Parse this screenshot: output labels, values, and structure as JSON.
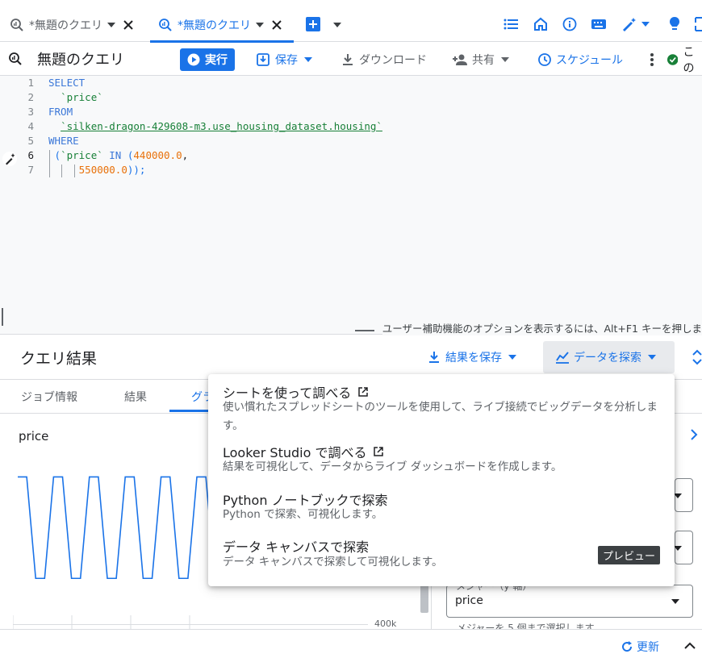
{
  "tabs": [
    {
      "label": "*無題のクエリ",
      "active": false
    },
    {
      "label": "*無題のクエリ",
      "active": true
    }
  ],
  "query": {
    "title": "無題のクエリ",
    "run_label": "実行",
    "save_label": "保存",
    "download_label": "ダウンロード",
    "share_label": "共有",
    "schedule_label": "スケジュール",
    "status_label": "この"
  },
  "editor": {
    "line_numbers": [
      "1",
      "2",
      "3",
      "4",
      "5",
      "6",
      "7"
    ],
    "kw_select": "SELECT",
    "col_price": "`price`",
    "kw_from": "FROM",
    "table_ref": "`silken-dragon-429608-m3.use_housing_dataset.housing`",
    "kw_where": "WHERE",
    "l6_open": "(",
    "l6_col": "`price`",
    "l6_in": "IN",
    "l6_paren": "(",
    "l6_num": "440000.0",
    "l6_comma": ",",
    "l7_num": "550000.0",
    "l7_close": "));",
    "accessibility_hint": "ユーザー補助機能のオプションを表示するには、Alt+F1 キーを押しま"
  },
  "results": {
    "title": "クエリ結果",
    "save_results_label": "結果を保存",
    "explore_label": "データを探索",
    "tabs": [
      "ジョブ情報",
      "結果",
      "グラ"
    ],
    "chart_label": "price",
    "axis_tick": "400k"
  },
  "menu": {
    "items": [
      {
        "title": "シートを使って調べる",
        "desc": "使い慣れたスプレッドシートのツールを使用して、ライブ接続でビッグデータを分析します。"
      },
      {
        "title": "Looker Studio で調べる",
        "desc": "結果を可視化して、データからライブ ダッシュボードを作成します。"
      },
      {
        "title": "Python ノートブックで探索",
        "desc": "Python で探索、可視化します。"
      },
      {
        "title": "データ キャンバスで探索",
        "desc": "データ キャンバスで探索して可視化します。"
      }
    ],
    "preview_badge": "プレビュー"
  },
  "config": {
    "measure_label": "メジャー（y 軸）",
    "measure_value": "price",
    "measure_hint": "メジャーを 5 個まで選択します"
  },
  "footer": {
    "refresh_label": "更新"
  },
  "colors": {
    "accent": "#1a73e8",
    "series": "#1a73e8",
    "success": "#188038"
  },
  "chart_data": {
    "type": "line",
    "series": [
      {
        "name": "price",
        "values": [
          550000,
          550000,
          440000,
          440000,
          550000,
          550000,
          440000,
          440000,
          550000,
          550000,
          440000,
          440000,
          550000,
          550000,
          440000,
          440000,
          550000,
          550000,
          440000,
          440000,
          550000,
          550000,
          440000,
          440000,
          550000
        ]
      }
    ],
    "y_tick": "400k",
    "ylim": [
      400000,
      560000
    ]
  }
}
